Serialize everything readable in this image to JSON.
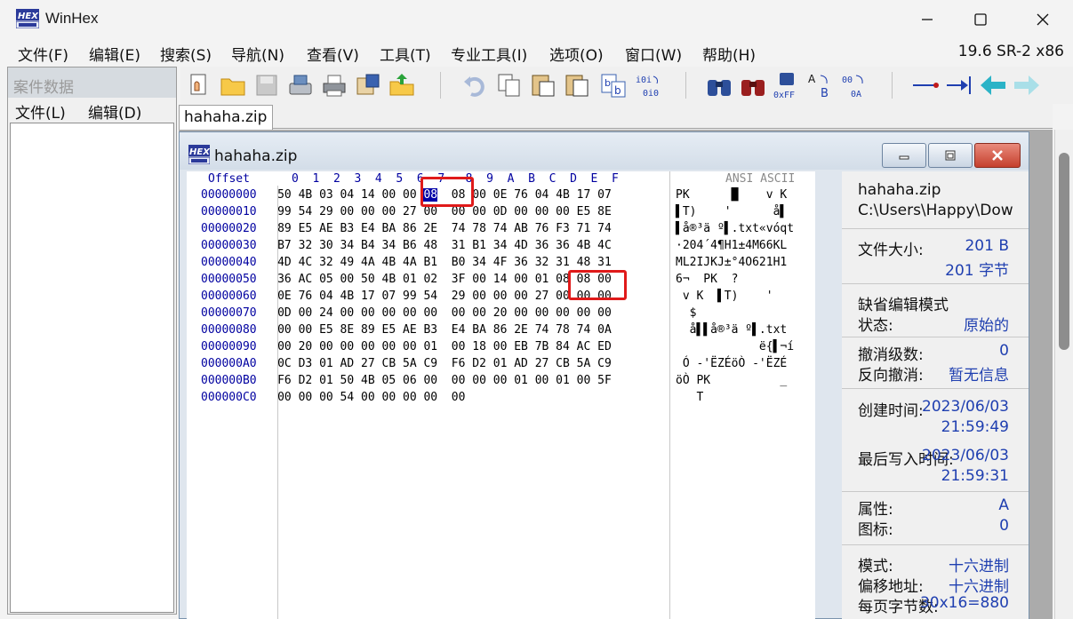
{
  "window": {
    "title": "WinHex",
    "version": "19.6 SR-2 x86"
  },
  "menu": [
    "文件(F)",
    "编辑(E)",
    "搜索(S)",
    "导航(N)",
    "查看(V)",
    "工具(T)",
    "专业工具(I)",
    "选项(O)",
    "窗口(W)",
    "帮助(H)"
  ],
  "case_panel": {
    "title": "案件数据",
    "menu_file": "文件(L)",
    "menu_edit": "编辑(D)"
  },
  "tab": {
    "label": "hahaha.zip"
  },
  "child": {
    "title": "hahaha.zip"
  },
  "hex": {
    "offset_label": "Offset",
    "columns": "0  1  2  3  4  5  6  7   8  9  A  B  C  D  E  F",
    "ansi_label": "ANSI ASCII",
    "rows": [
      {
        "offset": "00000000",
        "a": "50 4B 03 04 14 00 00 ",
        "sel": "08",
        "b": "  08 00 0E 76 04 4B 17 07",
        "ansi": "PK      █    v K"
      },
      {
        "offset": "00000010",
        "a": "99 54 29 00 00 00 27 00",
        "sel": "",
        "b": "  00 00 0D 00 00 00 E5 8E",
        "ansi": "▌T)    '      å▌"
      },
      {
        "offset": "00000020",
        "a": "89 E5 AE B3 E4 BA 86 2E",
        "sel": "",
        "b": "  74 78 74 AB 76 F3 71 74",
        "ansi": "▌å®³ä º▌.txt«vóqt"
      },
      {
        "offset": "00000030",
        "a": "B7 32 30 34 B4 34 B6 48",
        "sel": "",
        "b": "  31 B1 34 4D 36 36 4B 4C",
        "ansi": "·204´4¶H1±4M66KL"
      },
      {
        "offset": "00000040",
        "a": "4D 4C 32 49 4A 4B 4A B1",
        "sel": "",
        "b": "  B0 34 4F 36 32 31 48 31",
        "ansi": "ML2IJKJ±°4O621H1"
      },
      {
        "offset": "00000050",
        "a": "36 AC 05 00 50 4B 01 02",
        "sel": "",
        "b": "  3F 00 14 00 01 08 08 00",
        "ansi": "6¬  PK  ?"
      },
      {
        "offset": "00000060",
        "a": "0E 76 04 4B 17 07 99 54",
        "sel": "",
        "b": "  29 00 00 00 27 00 00 00",
        "ansi": " v K  ▌T)    '"
      },
      {
        "offset": "00000070",
        "a": "0D 00 24 00 00 00 00 00",
        "sel": "",
        "b": "  00 00 20 00 00 00 00 00",
        "ansi": "  $"
      },
      {
        "offset": "00000080",
        "a": "00 00 E5 8E 89 E5 AE B3",
        "sel": "",
        "b": "  E4 BA 86 2E 74 78 74 0A",
        "ansi": "  å▌▌å®³ä º▌.txt"
      },
      {
        "offset": "00000090",
        "a": "00 20 00 00 00 00 00 01",
        "sel": "",
        "b": "  00 18 00 EB 7B 84 AC ED",
        "ansi": "            ë{▌¬í"
      },
      {
        "offset": "000000A0",
        "a": "0C D3 01 AD 27 CB 5A C9",
        "sel": "",
        "b": "  F6 D2 01 AD 27 CB 5A C9",
        "ansi": " Ó -'ËZÉöÒ -'ËZÉ"
      },
      {
        "offset": "000000B0",
        "a": "F6 D2 01 50 4B 05 06 00",
        "sel": "",
        "b": "  00 00 00 01 00 01 00 5F",
        "ansi": "öÒ PK          _"
      },
      {
        "offset": "000000C0",
        "a": "00 00 00 54 00 00 00 00",
        "sel": "",
        "b": "  00",
        "ansi": "   T"
      }
    ]
  },
  "info": {
    "filename": "hahaha.zip",
    "path": "C:\\Users\\Happy\\Dow",
    "size_label": "文件大小:",
    "size_bytes": "201 B",
    "size_zh": "201 字节",
    "edit_mode_label": "缺省编辑模式",
    "state_label": "状态:",
    "state_value": "原始的",
    "undo_label": "撤消级数:",
    "undo_value": "0",
    "redo_label": "反向撤消:",
    "redo_value": "暂无信息",
    "created_label": "创建时间:",
    "created_date": "2023/06/03",
    "created_time": "21:59:49",
    "written_label": "最后写入时间:",
    "written_date": "2023/06/03",
    "written_time": "21:59:31",
    "attr_label": "属性:",
    "attr_value": "A",
    "icon_label": "图标:",
    "icon_value": "0",
    "mode_label": "模式:",
    "mode_value": "十六进制",
    "offset_label": "偏移地址:",
    "offset_value": "十六进制",
    "bpp_label": "每页字节数:",
    "bpp_value": "30x16=880"
  }
}
